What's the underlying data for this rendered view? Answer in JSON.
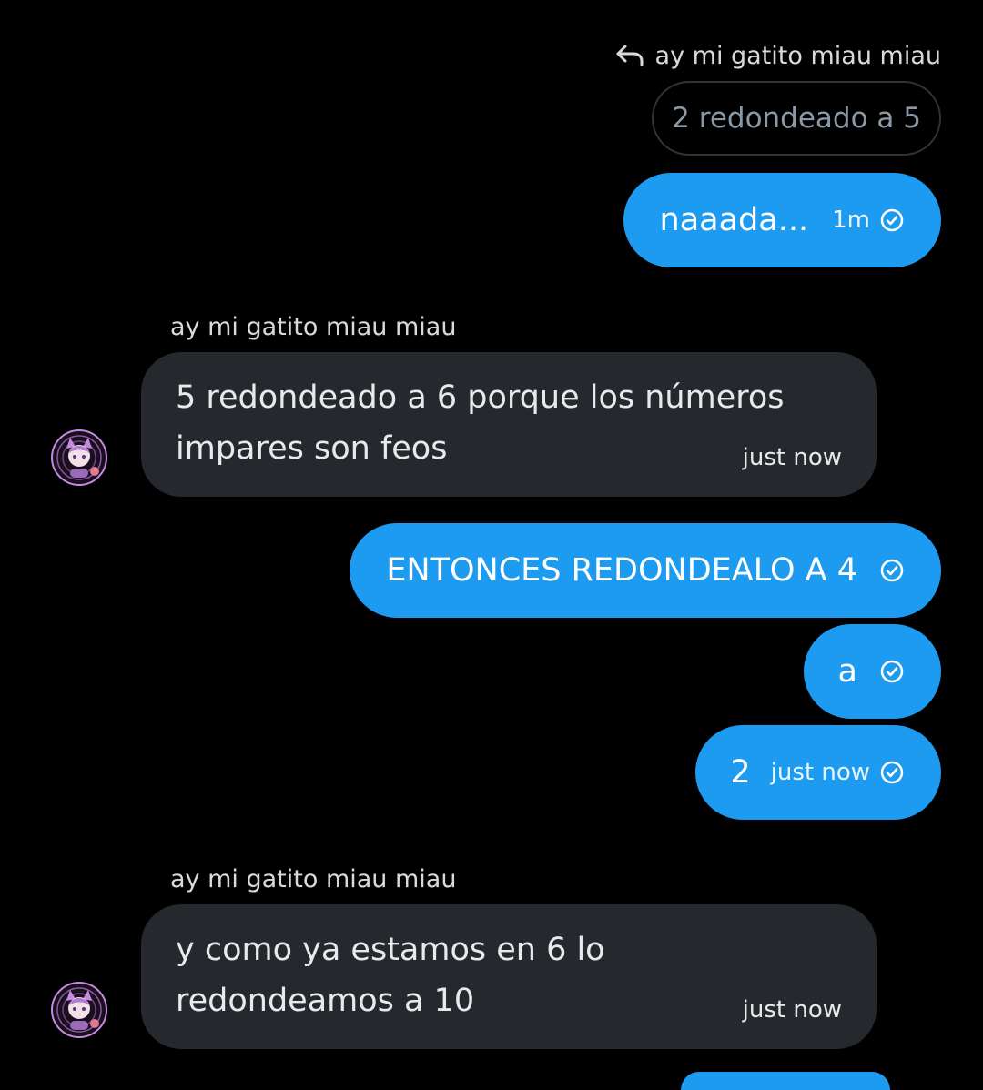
{
  "reply": {
    "to_name": "ay mi gatito miau miau",
    "quoted_text": "2 redondeado a 5"
  },
  "messages": [
    {
      "direction": "out",
      "text": "naaada...",
      "time": "1m",
      "status": "sent-check-icon"
    },
    {
      "direction": "in",
      "sender": "ay mi gatito miau miau",
      "line1": "5 redondeado a 6 porque los números",
      "line2": "impares son feos",
      "time": "just now"
    },
    {
      "direction": "out",
      "text": "ENTONCES REDONDEALO A 4",
      "status": "sent-check-icon"
    },
    {
      "direction": "out",
      "text": "a",
      "status": "sent-check-icon"
    },
    {
      "direction": "out",
      "text": "2",
      "time": "just now",
      "status": "sent-check-icon"
    },
    {
      "direction": "in",
      "sender": "ay mi gatito miau miau",
      "line1": "y como ya estamos en 6 lo",
      "line2": "redondeamos a 10",
      "time": "just now"
    }
  ],
  "colors": {
    "background": "#000000",
    "outgoing_bubble": "#1d9bf0",
    "incoming_bubble": "#25292e",
    "muted_text": "#8b98a5",
    "avatar_accent": "#c58be0"
  }
}
